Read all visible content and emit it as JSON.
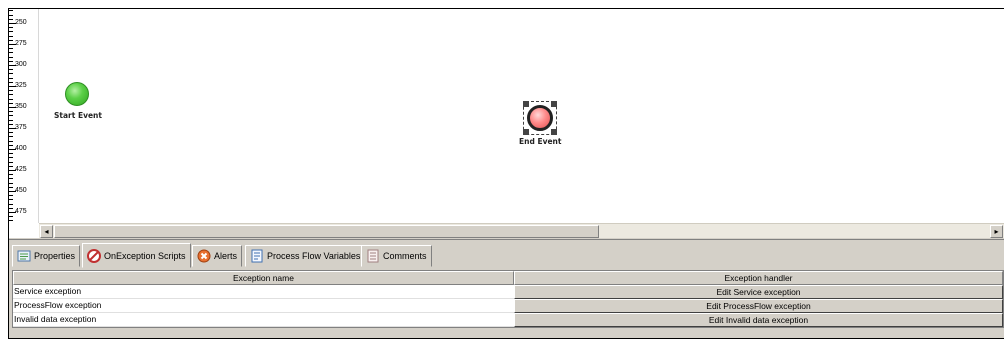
{
  "ruler": {
    "labels": [
      "250",
      "275",
      "300",
      "325",
      "350",
      "375",
      "400",
      "425",
      "450",
      "475"
    ]
  },
  "canvas": {
    "start_event_label": "Start Event",
    "end_event_label": "End Event"
  },
  "tabs": [
    {
      "label": "Properties",
      "icon": "properties-icon"
    },
    {
      "label": "OnException Scripts",
      "icon": "exception-scripts-icon"
    },
    {
      "label": "Alerts",
      "icon": "alerts-icon"
    },
    {
      "label": "Process Flow Variables",
      "icon": "variables-icon"
    },
    {
      "label": "Comments",
      "icon": "comments-icon"
    }
  ],
  "active_tab": "OnException Scripts",
  "table": {
    "headers": [
      "Exception name",
      "Exception handler"
    ],
    "rows": [
      {
        "name": "Service exception",
        "handler": "Edit Service exception"
      },
      {
        "name": "ProcessFlow exception",
        "handler": "Edit ProcessFlow exception"
      },
      {
        "name": "Invalid data exception",
        "handler": "Edit Invalid data exception"
      }
    ]
  },
  "scrollbar": {
    "left_arrow": "◂",
    "right_arrow": "▸"
  }
}
